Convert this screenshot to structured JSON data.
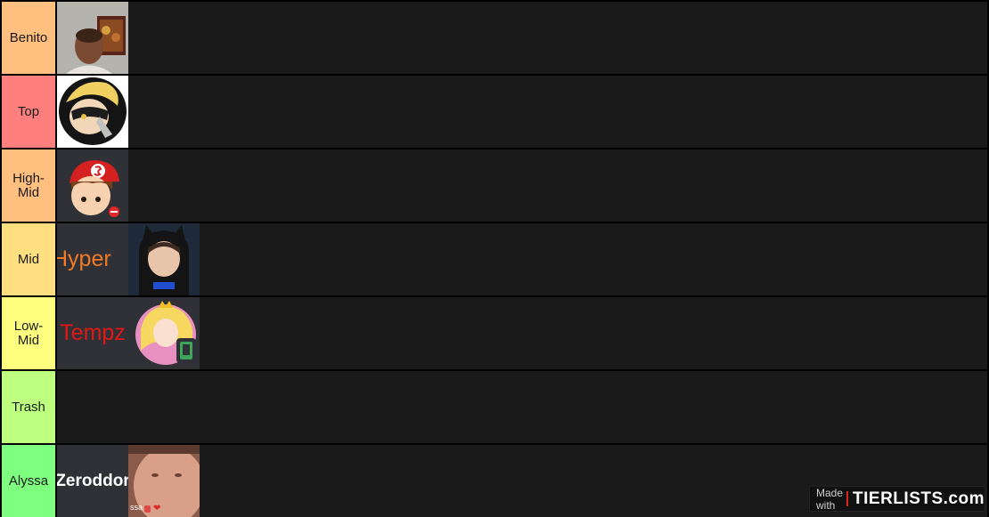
{
  "tiers": [
    {
      "label": "Benito",
      "color": "#ffbf7f"
    },
    {
      "label": "Top",
      "color": "#ff7f7f"
    },
    {
      "label": "High-Mid",
      "color": "#ffbf7f"
    },
    {
      "label": "Mid",
      "color": "#ffdf7f"
    },
    {
      "label": "Low-Mid",
      "color": "#ffff7f"
    },
    {
      "label": "Trash",
      "color": "#bfff7f"
    },
    {
      "label": "Alyssa",
      "color": "#7fff7f"
    }
  ],
  "items": {
    "mid_text": "Hyper",
    "low_mid_text": "Tempz",
    "alyssa_text": "Zeroddor",
    "alyssa_photo_caption": "ssa"
  },
  "watermark": {
    "made_with": "Made with",
    "brand": "TIERLISTS.com"
  }
}
